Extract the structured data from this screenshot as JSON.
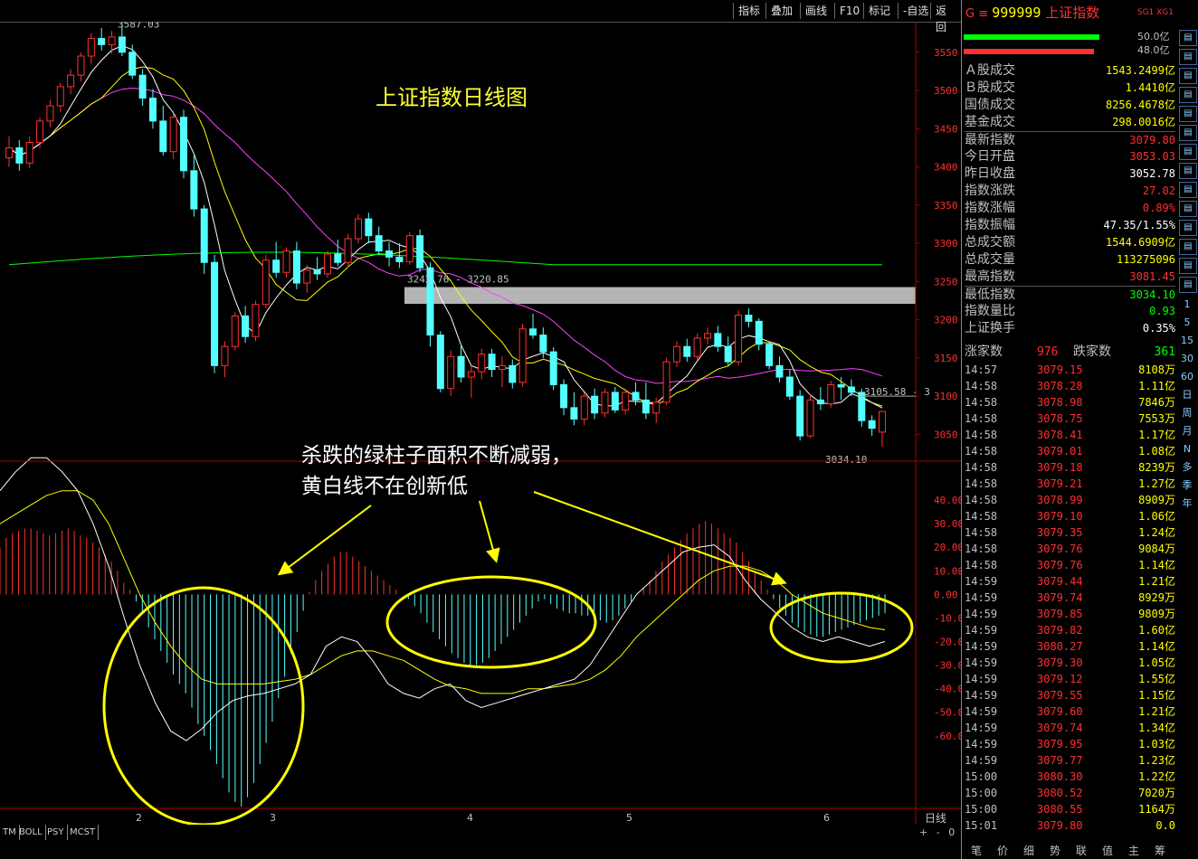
{
  "toolbar": {
    "buttons": [
      "指标",
      "叠加",
      "画线",
      "F10",
      "标记",
      "-自选",
      "返回"
    ]
  },
  "chart_title": "上证指数日线图",
  "annotation": {
    "line1": "杀跌的绿柱子面积不断减弱，",
    "line2": "黄白线不在创新低"
  },
  "price_labels": {
    "high": "3587.03",
    "low": "3034.10",
    "range": "3242.76 - 3220.85",
    "last": "3105.58 - 3"
  },
  "chart_data": [
    {
      "type": "candlestick",
      "title": "上证指数日线图",
      "y_ticks": [
        3050,
        3100,
        3150,
        3200,
        3250,
        3300,
        3350,
        3400,
        3450,
        3500,
        3550
      ],
      "ylim": [
        3015,
        3590
      ],
      "x_tick_labels": [
        "2",
        "3",
        "4",
        "5",
        "6"
      ],
      "high_mark": 3587.03,
      "low_mark": 3034.1,
      "resistance_band": [
        3220.85,
        3242.76
      ],
      "colors": {
        "up": "#ff3030",
        "down": "#54ffff",
        "ma5": "#ffffff",
        "ma10": "#ffff00",
        "ma20": "#ff40ff",
        "ma60": "#00ff00"
      },
      "candles": [
        [
          3412,
          3440,
          3400,
          3425
        ],
        [
          3425,
          3435,
          3395,
          3405
        ],
        [
          3405,
          3440,
          3398,
          3432
        ],
        [
          3432,
          3465,
          3425,
          3460
        ],
        [
          3460,
          3488,
          3452,
          3480
        ],
        [
          3480,
          3510,
          3472,
          3505
        ],
        [
          3505,
          3528,
          3495,
          3520
        ],
        [
          3520,
          3550,
          3512,
          3545
        ],
        [
          3545,
          3575,
          3535,
          3568
        ],
        [
          3568,
          3582,
          3552,
          3560
        ],
        [
          3560,
          3578,
          3548,
          3570
        ],
        [
          3570,
          3587,
          3545,
          3550
        ],
        [
          3550,
          3560,
          3515,
          3520
        ],
        [
          3520,
          3528,
          3480,
          3490
        ],
        [
          3490,
          3502,
          3450,
          3460
        ],
        [
          3460,
          3480,
          3415,
          3420
        ],
        [
          3420,
          3470,
          3410,
          3465
        ],
        [
          3465,
          3475,
          3385,
          3395
        ],
        [
          3395,
          3415,
          3335,
          3345
        ],
        [
          3345,
          3350,
          3260,
          3275
        ],
        [
          3275,
          3285,
          3130,
          3140
        ],
        [
          3140,
          3172,
          3125,
          3165
        ],
        [
          3165,
          3210,
          3160,
          3205
        ],
        [
          3205,
          3218,
          3170,
          3178
        ],
        [
          3178,
          3225,
          3172,
          3220
        ],
        [
          3220,
          3285,
          3215,
          3278
        ],
        [
          3278,
          3302,
          3255,
          3262
        ],
        [
          3262,
          3295,
          3255,
          3290
        ],
        [
          3290,
          3302,
          3240,
          3248
        ],
        [
          3248,
          3272,
          3235,
          3265
        ],
        [
          3265,
          3282,
          3252,
          3260
        ],
        [
          3260,
          3290,
          3255,
          3286
        ],
        [
          3286,
          3305,
          3270,
          3275
        ],
        [
          3275,
          3312,
          3268,
          3306
        ],
        [
          3306,
          3338,
          3300,
          3332
        ],
        [
          3332,
          3340,
          3300,
          3310
        ],
        [
          3310,
          3322,
          3285,
          3290
        ],
        [
          3290,
          3302,
          3270,
          3282
        ],
        [
          3282,
          3300,
          3268,
          3276
        ],
        [
          3276,
          3315,
          3272,
          3310
        ],
        [
          3310,
          3318,
          3262,
          3268
        ],
        [
          3268,
          3275,
          3165,
          3180
        ],
        [
          3180,
          3185,
          3105,
          3110
        ],
        [
          3110,
          3160,
          3100,
          3152
        ],
        [
          3152,
          3168,
          3118,
          3125
        ],
        [
          3125,
          3140,
          3098,
          3132
        ],
        [
          3132,
          3162,
          3122,
          3155
        ],
        [
          3155,
          3162,
          3125,
          3135
        ],
        [
          3135,
          3152,
          3112,
          3140
        ],
        [
          3140,
          3148,
          3110,
          3118
        ],
        [
          3118,
          3195,
          3112,
          3188
        ],
        [
          3188,
          3208,
          3175,
          3180
        ],
        [
          3180,
          3190,
          3150,
          3158
        ],
        [
          3158,
          3164,
          3108,
          3115
        ],
        [
          3115,
          3122,
          3075,
          3085
        ],
        [
          3085,
          3105,
          3062,
          3070
        ],
        [
          3070,
          3105,
          3062,
          3100
        ],
        [
          3100,
          3110,
          3070,
          3078
        ],
        [
          3078,
          3110,
          3072,
          3105
        ],
        [
          3105,
          3112,
          3078,
          3082
        ],
        [
          3082,
          3110,
          3076,
          3105
        ],
        [
          3105,
          3118,
          3088,
          3095
        ],
        [
          3095,
          3118,
          3070,
          3078
        ],
        [
          3078,
          3098,
          3065,
          3092
        ],
        [
          3092,
          3150,
          3088,
          3145
        ],
        [
          3145,
          3172,
          3138,
          3165
        ],
        [
          3165,
          3175,
          3145,
          3152
        ],
        [
          3152,
          3182,
          3148,
          3176
        ],
        [
          3176,
          3190,
          3168,
          3182
        ],
        [
          3182,
          3192,
          3158,
          3165
        ],
        [
          3165,
          3178,
          3140,
          3145
        ],
        [
          3145,
          3212,
          3140,
          3206
        ],
        [
          3206,
          3215,
          3190,
          3198
        ],
        [
          3198,
          3202,
          3160,
          3168
        ],
        [
          3168,
          3172,
          3135,
          3140
        ],
        [
          3140,
          3152,
          3118,
          3125
        ],
        [
          3125,
          3135,
          3095,
          3100
        ],
        [
          3100,
          3108,
          3042,
          3048
        ],
        [
          3048,
          3102,
          3045,
          3095
        ],
        [
          3095,
          3112,
          3082,
          3090
        ],
        [
          3090,
          3120,
          3085,
          3115
        ],
        [
          3115,
          3125,
          3095,
          3112
        ],
        [
          3112,
          3122,
          3100,
          3105
        ],
        [
          3105,
          3110,
          3060,
          3068
        ],
        [
          3068,
          3075,
          3048,
          3058
        ],
        [
          3053,
          3081,
          3034,
          3080
        ]
      ],
      "ma60_range": [
        3272,
        3290
      ]
    },
    {
      "type": "bar",
      "title": "",
      "y_ticks": [
        40,
        30,
        20,
        10,
        0,
        -10,
        -20,
        -30,
        -40,
        -50,
        -60
      ],
      "ylim": [
        -90,
        55
      ],
      "series": [
        {
          "values": [
            20,
            24,
            26,
            27,
            28,
            28,
            27,
            26,
            25,
            26,
            27,
            28,
            27,
            25,
            24,
            22,
            20,
            17,
            14,
            10,
            5,
            2,
            -3,
            -8,
            -14,
            -19,
            -24,
            -29,
            -34,
            -38,
            -42,
            -48,
            -55,
            -60,
            -66,
            -72,
            -78,
            -84,
            -88,
            -90,
            -86,
            -80,
            -72,
            -63,
            -54,
            -44,
            -35,
            -25,
            -16,
            -7,
            1,
            6,
            10,
            13,
            16,
            18,
            18,
            16,
            14,
            12,
            10,
            8,
            6,
            4,
            2,
            0,
            -2,
            -5,
            -8,
            -12,
            -16,
            -19,
            -22,
            -25,
            -27,
            -29,
            -30,
            -30,
            -29,
            -27,
            -24,
            -21,
            -18,
            -15,
            -12,
            -9,
            -6,
            -3,
            -2,
            -4,
            -6,
            -7,
            -8,
            -8,
            -9,
            -9,
            -10,
            -11,
            -12,
            -11,
            -9,
            -6,
            -3,
            0,
            3,
            6,
            10,
            14,
            17,
            20,
            23,
            26,
            28,
            30,
            31,
            30,
            28,
            26,
            24,
            22,
            18,
            14,
            10,
            6,
            2,
            -2,
            -6,
            -9,
            -12,
            -14,
            -16,
            -17,
            -18,
            -18,
            -17,
            -16,
            -15,
            -14,
            -13,
            -12,
            -11,
            -10,
            -9,
            -8
          ]
        }
      ],
      "dif": [
        44,
        52,
        58,
        58,
        52,
        44,
        30,
        12,
        -10,
        -30,
        -46,
        -58,
        -62,
        -57,
        -50,
        -45,
        -43,
        -42,
        -40,
        -38,
        -34,
        -22,
        -18,
        -20,
        -28,
        -38,
        -42,
        -44,
        -40,
        -38,
        -45,
        -48,
        -46,
        -44,
        -42,
        -40,
        -38,
        -36,
        -30,
        -20,
        -10,
        0,
        6,
        12,
        18,
        20,
        21,
        16,
        6,
        -2,
        -8,
        -14,
        -18,
        -20,
        -18,
        -20,
        -22,
        -20
      ],
      "dea": [
        30,
        34,
        38,
        42,
        44,
        44,
        40,
        30,
        15,
        0,
        -12,
        -22,
        -30,
        -36,
        -38,
        -38,
        -38,
        -38,
        -37,
        -36,
        -34,
        -30,
        -26,
        -24,
        -24,
        -26,
        -28,
        -32,
        -36,
        -39,
        -40,
        -42,
        -42,
        -42,
        -40,
        -40,
        -39,
        -38,
        -36,
        -32,
        -26,
        -18,
        -12,
        -6,
        0,
        6,
        10,
        12,
        12,
        10,
        6,
        0,
        -4,
        -8,
        -10,
        -12,
        -14,
        -15
      ]
    }
  ],
  "right_panel": {
    "code": "999999",
    "name": "上证指数",
    "tags": "SG1 XG1",
    "bar_vals": [
      "50.0亿",
      "48.0亿"
    ],
    "stats": [
      {
        "label": "Ａ股成交",
        "value": "1543.2499亿",
        "color": "#ffff00"
      },
      {
        "label": "Ｂ股成交",
        "value": "1.4410亿",
        "color": "#ffff00"
      },
      {
        "label": "国债成交",
        "value": "8256.4678亿",
        "color": "#ffff00"
      },
      {
        "label": "基金成交",
        "value": "298.0016亿",
        "color": "#ffff00"
      },
      {
        "label": "最新指数",
        "value": "3079.80",
        "color": "#ff3030"
      },
      {
        "label": "今日开盘",
        "value": "3053.03",
        "color": "#ff3030"
      },
      {
        "label": "昨日收盘",
        "value": "3052.78",
        "color": "#ffffff"
      },
      {
        "label": "指数涨跌",
        "value": "27.02",
        "color": "#ff3030"
      },
      {
        "label": "指数涨幅",
        "value": "0.89%",
        "color": "#ff3030"
      },
      {
        "label": "指数振幅",
        "value": "47.35/1.55%",
        "color": "#ffffff"
      },
      {
        "label": "总成交额",
        "value": "1544.6909亿",
        "color": "#ffff00"
      },
      {
        "label": "总成交量",
        "value": "113275096",
        "color": "#ffff00"
      },
      {
        "label": "最高指数",
        "value": "3081.45",
        "color": "#ff3030"
      },
      {
        "label": "最低指数",
        "value": "3034.10",
        "color": "#00ff00"
      },
      {
        "label": "指数量比",
        "value": "0.93",
        "color": "#00ff00"
      },
      {
        "label": "上证换手",
        "value": "0.35%",
        "color": "#ffffff"
      }
    ],
    "breadth": {
      "up_label": "涨家数",
      "up_value": "976",
      "down_label": "跌家数",
      "down_value": "361"
    },
    "ticks": [
      [
        "14:57",
        "3079.15",
        "8108万"
      ],
      [
        "14:58",
        "3078.28",
        "1.11亿"
      ],
      [
        "14:58",
        "3078.98",
        "7846万"
      ],
      [
        "14:58",
        "3078.75",
        "7553万"
      ],
      [
        "14:58",
        "3078.41",
        "1.17亿"
      ],
      [
        "14:58",
        "3079.01",
        "1.08亿"
      ],
      [
        "14:58",
        "3079.18",
        "8239万"
      ],
      [
        "14:58",
        "3079.21",
        "1.27亿"
      ],
      [
        "14:58",
        "3078.99",
        "8909万"
      ],
      [
        "14:58",
        "3079.10",
        "1.06亿"
      ],
      [
        "14:58",
        "3079.35",
        "1.24亿"
      ],
      [
        "14:58",
        "3079.76",
        "9084万"
      ],
      [
        "14:58",
        "3079.76",
        "1.14亿"
      ],
      [
        "14:59",
        "3079.44",
        "1.21亿"
      ],
      [
        "14:59",
        "3079.74",
        "8929万"
      ],
      [
        "14:59",
        "3079.85",
        "9809万"
      ],
      [
        "14:59",
        "3079.82",
        "1.60亿"
      ],
      [
        "14:59",
        "3080.27",
        "1.14亿"
      ],
      [
        "14:59",
        "3079.30",
        "1.05亿"
      ],
      [
        "14:59",
        "3079.12",
        "1.55亿"
      ],
      [
        "14:59",
        "3079.55",
        "1.15亿"
      ],
      [
        "14:59",
        "3079.60",
        "1.21亿"
      ],
      [
        "14:59",
        "3079.74",
        "1.34亿"
      ],
      [
        "14:59",
        "3079.95",
        "1.03亿"
      ],
      [
        "14:59",
        "3079.77",
        "1.23亿"
      ],
      [
        "15:00",
        "3080.30",
        "1.22亿"
      ],
      [
        "15:00",
        "3080.52",
        "7020万"
      ],
      [
        "15:00",
        "3080.55",
        "1164万"
      ],
      [
        "15:01",
        "3079.80",
        "0.0"
      ]
    ],
    "side_labels": [
      "1",
      "5",
      "15",
      "30",
      "60",
      "日",
      "周",
      "月",
      "N",
      "多",
      "季",
      "年"
    ],
    "bottom_tabs": [
      "笔",
      "价",
      "细",
      "势",
      "联",
      "值",
      "主",
      "筹"
    ]
  },
  "indicator_tabs": [
    "TM",
    "BOLL",
    "PSY",
    "MCST"
  ],
  "period_label": "日线",
  "zoom_controls": [
    "+",
    "-",
    "0"
  ]
}
